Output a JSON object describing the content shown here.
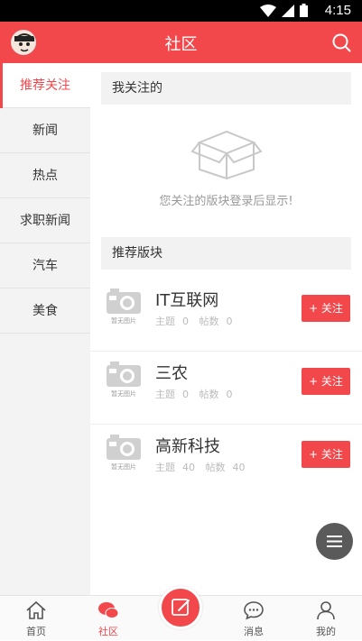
{
  "statusbar": {
    "time": "4:15"
  },
  "header": {
    "title": "社区"
  },
  "sidebar": {
    "items": [
      {
        "label": "推荐关注",
        "active": true
      },
      {
        "label": "新闻"
      },
      {
        "label": "热点"
      },
      {
        "label": "求职新闻"
      },
      {
        "label": "汽车"
      },
      {
        "label": "美食"
      }
    ]
  },
  "main": {
    "my_following_title": "我关注的",
    "empty_message": "您关注的版块登录后显示!",
    "recommended_title": "推荐版块",
    "boards": [
      {
        "name": "IT互联网",
        "thumb_caption": "暂无图片",
        "topics_label": "主题",
        "topics": "0",
        "posts_label": "帖数",
        "posts": "0",
        "follow_label": "+ 关注"
      },
      {
        "name": "三农",
        "thumb_caption": "暂无图片",
        "topics_label": "主题",
        "topics": "0",
        "posts_label": "帖数",
        "posts": "0",
        "follow_label": "+ 关注"
      },
      {
        "name": "高新科技",
        "thumb_caption": "暂无图片",
        "topics_label": "主题",
        "topics": "40",
        "posts_label": "帖数",
        "posts": "40",
        "follow_label": "+ 关注"
      }
    ]
  },
  "bottom_nav": {
    "tabs": [
      {
        "label": "首页",
        "icon": "home-icon"
      },
      {
        "label": "社区",
        "icon": "community-icon",
        "active": true
      },
      {
        "label": "消息",
        "icon": "message-icon"
      },
      {
        "label": "我的",
        "icon": "profile-icon"
      }
    ],
    "publish_icon": "edit-icon"
  },
  "colors": {
    "accent": "#f2474b",
    "sidebar_bg": "#f3f3f3",
    "muted_text": "#999999"
  }
}
